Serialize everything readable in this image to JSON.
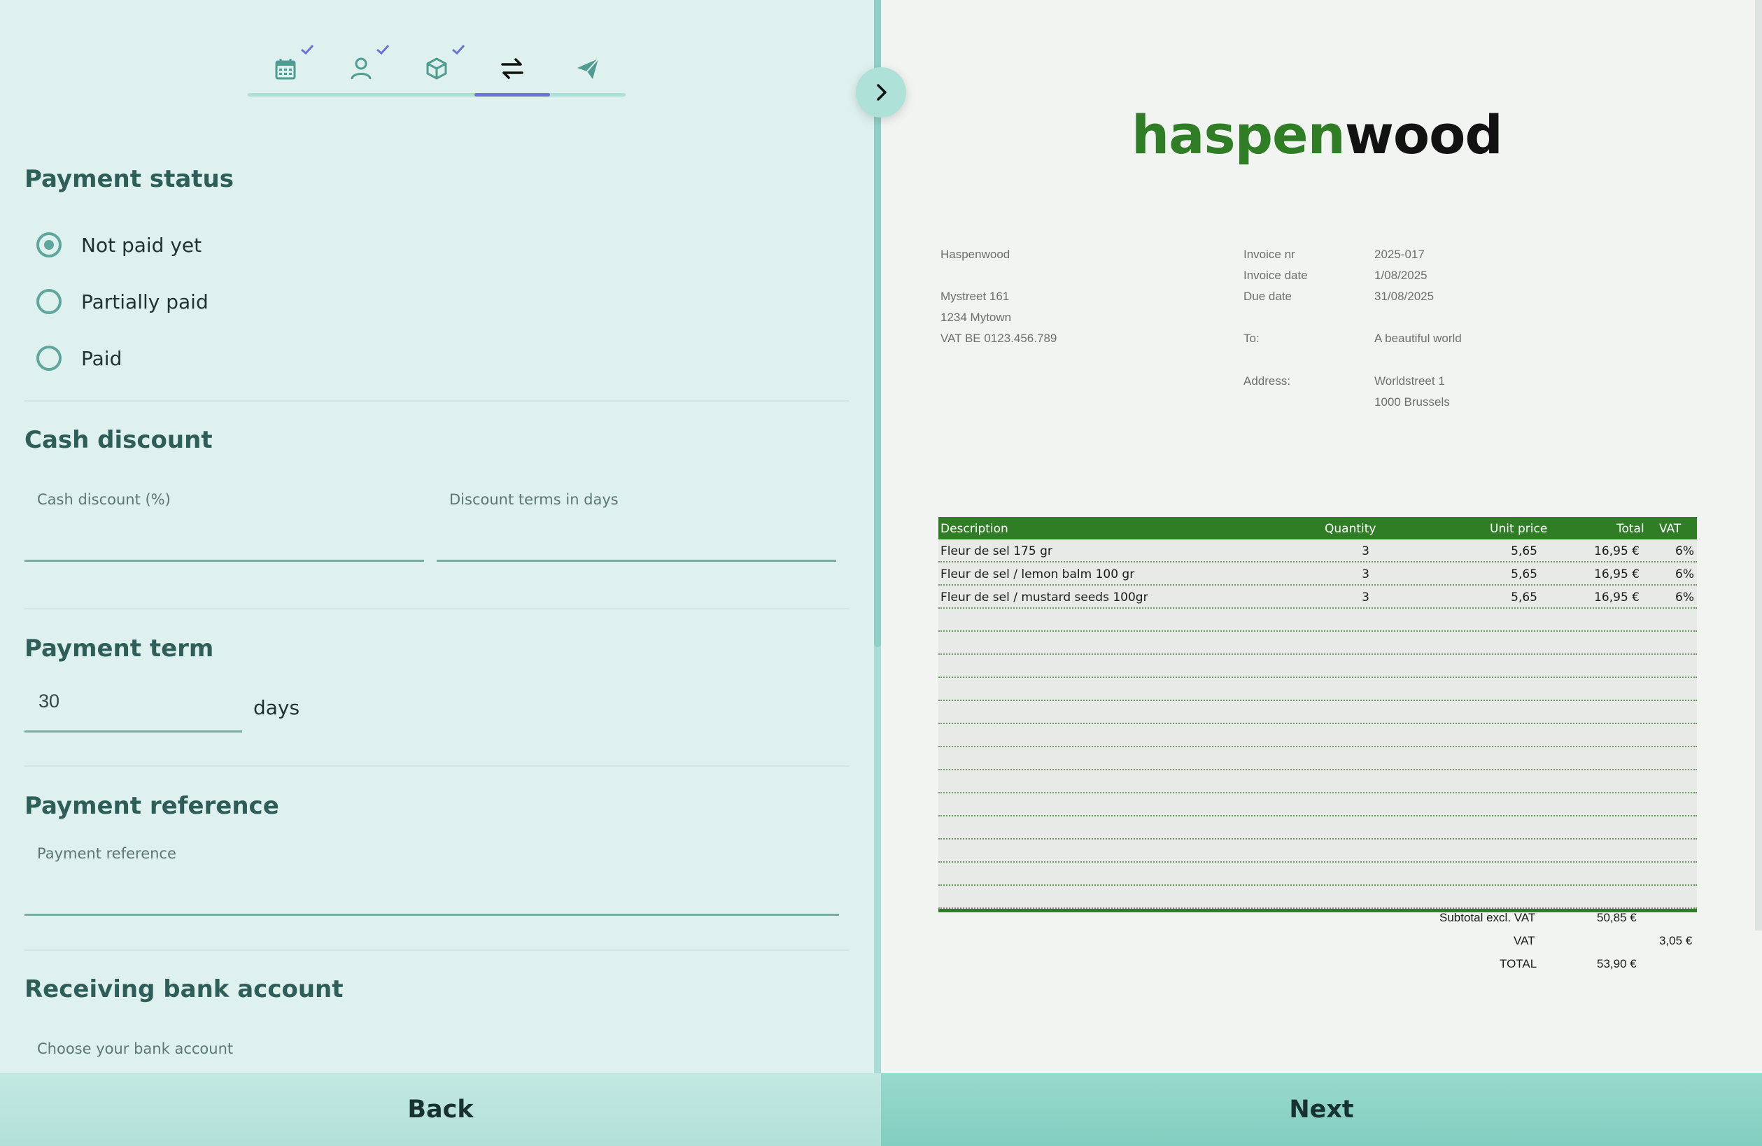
{
  "steps": [
    {
      "icon": "calendar-icon",
      "done": true,
      "active": false
    },
    {
      "icon": "person-icon",
      "done": true,
      "active": false
    },
    {
      "icon": "box-icon",
      "done": true,
      "active": false
    },
    {
      "icon": "transfer-icon",
      "done": false,
      "active": true
    },
    {
      "icon": "send-icon",
      "done": false,
      "active": false
    }
  ],
  "payment_status": {
    "title": "Payment status",
    "options": [
      {
        "label": "Not paid yet",
        "checked": true
      },
      {
        "label": "Partially paid",
        "checked": false
      },
      {
        "label": "Paid",
        "checked": false
      }
    ]
  },
  "cash_discount": {
    "title": "Cash discount",
    "percent_label": "Cash discount (%)",
    "percent_value": "",
    "terms_label": "Discount terms in days",
    "terms_value": ""
  },
  "payment_term": {
    "title": "Payment term",
    "value": "30",
    "unit": "days"
  },
  "payment_reference": {
    "title": "Payment reference",
    "label": "Payment reference",
    "value": ""
  },
  "bank_account": {
    "title": "Receiving bank account",
    "label": "Choose your bank account"
  },
  "buttons": {
    "back": "Back",
    "next": "Next"
  },
  "invoice": {
    "logo_part1": "haspen",
    "logo_part2": "wood",
    "sender": {
      "name": "Haspenwood",
      "street": "Mystreet 161",
      "city": "1234 Mytown",
      "vat": "VAT BE 0123.456.789"
    },
    "meta": {
      "invoice_nr_label": "Invoice nr",
      "invoice_nr": "2025-017",
      "invoice_date_label": "Invoice date",
      "invoice_date": "1/08/2025",
      "due_date_label": "Due date",
      "due_date": "31/08/2025",
      "to_label": "To:",
      "to": "A beautiful world",
      "address_label": "Address:",
      "address_line1": "Worldstreet 1",
      "address_line2": "1000 Brussels"
    },
    "columns": {
      "description": "Description",
      "quantity": "Quantity",
      "unit_price": "Unit price",
      "total": "Total",
      "vat": "VAT"
    },
    "lines": [
      {
        "description": "Fleur de sel 175 gr",
        "quantity": "3",
        "unit_price": "5,65",
        "total": "16,95 €",
        "vat": "6%"
      },
      {
        "description": "Fleur de sel / lemon balm 100 gr",
        "quantity": "3",
        "unit_price": "5,65",
        "total": "16,95 €",
        "vat": "6%"
      },
      {
        "description": "Fleur de sel / mustard seeds 100gr",
        "quantity": "3",
        "unit_price": "5,65",
        "total": "16,95 €",
        "vat": "6%"
      }
    ],
    "empty_rows": 13,
    "totals": {
      "subtotal_label": "Subtotal excl. VAT",
      "subtotal": "50,85 €",
      "vat_label": "VAT",
      "vat": "3,05 €",
      "total_label": "TOTAL",
      "total": "53,90 €"
    }
  },
  "colors": {
    "accent": "#6d72d8",
    "brand_green": "#2f7d25",
    "teal": "#5ea79c"
  }
}
